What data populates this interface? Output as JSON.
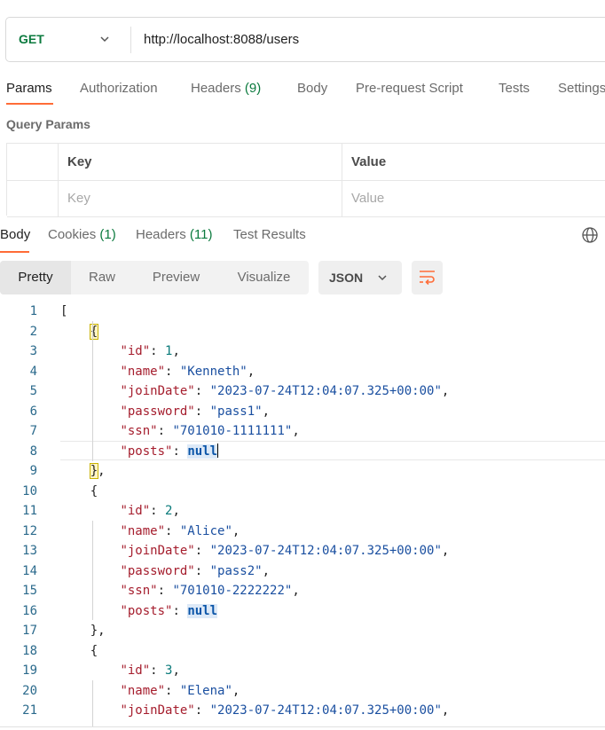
{
  "request": {
    "method": "GET",
    "url": "http://localhost:8088/users"
  },
  "request_tabs": [
    {
      "label": "Params",
      "count": "",
      "active": true
    },
    {
      "label": "Authorization",
      "count": ""
    },
    {
      "label": "Headers",
      "count": "(9)"
    },
    {
      "label": "Body",
      "count": ""
    },
    {
      "label": "Pre-request Script",
      "count": ""
    },
    {
      "label": "Tests",
      "count": ""
    },
    {
      "label": "Settings",
      "count": ""
    }
  ],
  "query_params": {
    "title": "Query Params",
    "headers": [
      "Key",
      "Value"
    ],
    "placeholders": [
      "Key",
      "Value"
    ]
  },
  "response_tabs": [
    {
      "label": "Body",
      "count": "",
      "active": true
    },
    {
      "label": "Cookies",
      "count": "(1)"
    },
    {
      "label": "Headers",
      "count": "(11)"
    },
    {
      "label": "Test Results",
      "count": ""
    }
  ],
  "view_modes": [
    "Pretty",
    "Raw",
    "Preview",
    "Visualize"
  ],
  "active_view_mode": "Pretty",
  "format": "JSON",
  "icons": {
    "method_dropdown": "chevron-down-icon",
    "format_dropdown": "chevron-down-icon",
    "globe": "globe-icon",
    "wrap": "wrap-lines-icon"
  },
  "colors": {
    "accent": "#ff6c37",
    "method": "#0b7a3e",
    "json_key": "#a51d2d",
    "json_string": "#1a4fa0",
    "json_number": "#0a7a7a",
    "json_null": "#0b55a8",
    "line_number": "#2b6a8c"
  },
  "code_lines": [
    {
      "n": "1",
      "indent": "",
      "tokens": [
        {
          "t": "p",
          "v": "["
        }
      ]
    },
    {
      "n": "2",
      "indent": "    ",
      "tokens": [
        {
          "t": "bk",
          "v": "{"
        }
      ]
    },
    {
      "n": "3",
      "indent": "        ",
      "tokens": [
        {
          "t": "k",
          "v": "\"id\""
        },
        {
          "t": "p",
          "v": ": "
        },
        {
          "t": "n",
          "v": "1"
        },
        {
          "t": "p",
          "v": ","
        }
      ]
    },
    {
      "n": "4",
      "indent": "        ",
      "tokens": [
        {
          "t": "k",
          "v": "\"name\""
        },
        {
          "t": "p",
          "v": ": "
        },
        {
          "t": "s",
          "v": "\"Kenneth\""
        },
        {
          "t": "p",
          "v": ","
        }
      ]
    },
    {
      "n": "5",
      "indent": "        ",
      "tokens": [
        {
          "t": "k",
          "v": "\"joinDate\""
        },
        {
          "t": "p",
          "v": ": "
        },
        {
          "t": "s",
          "v": "\"2023-07-24T12:04:07.325+00:00\""
        },
        {
          "t": "p",
          "v": ","
        }
      ]
    },
    {
      "n": "6",
      "indent": "        ",
      "tokens": [
        {
          "t": "k",
          "v": "\"password\""
        },
        {
          "t": "p",
          "v": ": "
        },
        {
          "t": "s",
          "v": "\"pass1\""
        },
        {
          "t": "p",
          "v": ","
        }
      ]
    },
    {
      "n": "7",
      "indent": "        ",
      "tokens": [
        {
          "t": "k",
          "v": "\"ssn\""
        },
        {
          "t": "p",
          "v": ": "
        },
        {
          "t": "s",
          "v": "\"701010-1111111\""
        },
        {
          "t": "p",
          "v": ","
        }
      ]
    },
    {
      "n": "8",
      "indent": "        ",
      "tokens": [
        {
          "t": "k",
          "v": "\"posts\""
        },
        {
          "t": "p",
          "v": ": "
        },
        {
          "t": "nl",
          "v": "null"
        },
        {
          "t": "caret",
          "v": ""
        }
      ]
    },
    {
      "n": "9",
      "indent": "    ",
      "tokens": [
        {
          "t": "bk",
          "v": "}"
        },
        {
          "t": "p",
          "v": ","
        }
      ]
    },
    {
      "n": "10",
      "indent": "    ",
      "tokens": [
        {
          "t": "p",
          "v": "{"
        }
      ]
    },
    {
      "n": "11",
      "indent": "        ",
      "tokens": [
        {
          "t": "k",
          "v": "\"id\""
        },
        {
          "t": "p",
          "v": ": "
        },
        {
          "t": "n",
          "v": "2"
        },
        {
          "t": "p",
          "v": ","
        }
      ]
    },
    {
      "n": "12",
      "indent": "        ",
      "tokens": [
        {
          "t": "k",
          "v": "\"name\""
        },
        {
          "t": "p",
          "v": ": "
        },
        {
          "t": "s",
          "v": "\"Alice\""
        },
        {
          "t": "p",
          "v": ","
        }
      ]
    },
    {
      "n": "13",
      "indent": "        ",
      "tokens": [
        {
          "t": "k",
          "v": "\"joinDate\""
        },
        {
          "t": "p",
          "v": ": "
        },
        {
          "t": "s",
          "v": "\"2023-07-24T12:04:07.325+00:00\""
        },
        {
          "t": "p",
          "v": ","
        }
      ]
    },
    {
      "n": "14",
      "indent": "        ",
      "tokens": [
        {
          "t": "k",
          "v": "\"password\""
        },
        {
          "t": "p",
          "v": ": "
        },
        {
          "t": "s",
          "v": "\"pass2\""
        },
        {
          "t": "p",
          "v": ","
        }
      ]
    },
    {
      "n": "15",
      "indent": "        ",
      "tokens": [
        {
          "t": "k",
          "v": "\"ssn\""
        },
        {
          "t": "p",
          "v": ": "
        },
        {
          "t": "s",
          "v": "\"701010-2222222\""
        },
        {
          "t": "p",
          "v": ","
        }
      ]
    },
    {
      "n": "16",
      "indent": "        ",
      "tokens": [
        {
          "t": "k",
          "v": "\"posts\""
        },
        {
          "t": "p",
          "v": ": "
        },
        {
          "t": "nl",
          "v": "null"
        }
      ]
    },
    {
      "n": "17",
      "indent": "    ",
      "tokens": [
        {
          "t": "p",
          "v": "}"
        },
        {
          "t": "p",
          "v": ","
        }
      ]
    },
    {
      "n": "18",
      "indent": "    ",
      "tokens": [
        {
          "t": "p",
          "v": "{"
        }
      ]
    },
    {
      "n": "19",
      "indent": "        ",
      "tokens": [
        {
          "t": "k",
          "v": "\"id\""
        },
        {
          "t": "p",
          "v": ": "
        },
        {
          "t": "n",
          "v": "3"
        },
        {
          "t": "p",
          "v": ","
        }
      ]
    },
    {
      "n": "20",
      "indent": "        ",
      "tokens": [
        {
          "t": "k",
          "v": "\"name\""
        },
        {
          "t": "p",
          "v": ": "
        },
        {
          "t": "s",
          "v": "\"Elena\""
        },
        {
          "t": "p",
          "v": ","
        }
      ]
    },
    {
      "n": "21",
      "indent": "        ",
      "tokens": [
        {
          "t": "k",
          "v": "\"joinDate\""
        },
        {
          "t": "p",
          "v": ": "
        },
        {
          "t": "s",
          "v": "\"2023-07-24T12:04:07.325+00:00\""
        },
        {
          "t": "p",
          "v": ","
        }
      ]
    }
  ]
}
